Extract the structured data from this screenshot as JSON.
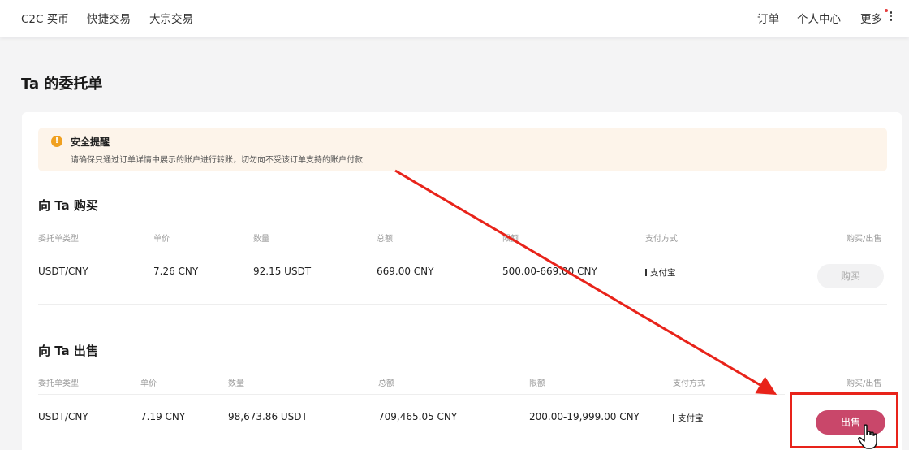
{
  "nav": {
    "left": [
      "C2C 买币",
      "快捷交易",
      "大宗交易"
    ],
    "orders": "订单",
    "profile": "个人中心",
    "more": "更多"
  },
  "page_title": "Ta 的委托单",
  "alert": {
    "icon": "!",
    "title": "安全提醒",
    "text": "请确保只通过订单详情中展示的账户进行转账，切勿向不受该订单支持的账户付款"
  },
  "buy_section": {
    "title": "向 Ta 购买",
    "headers": [
      "委托单类型",
      "单价",
      "数量",
      "总额",
      "限额",
      "支付方式",
      "购买/出售"
    ],
    "row": {
      "type": "USDT/CNY",
      "price": "7.26 CNY",
      "amount": "92.15 USDT",
      "total": "669.00 CNY",
      "limit": "500.00-669.00 CNY",
      "payment": "支付宝",
      "action": "购买"
    }
  },
  "sell_section": {
    "title": "向 Ta 出售",
    "headers": [
      "委托单类型",
      "单价",
      "数量",
      "总额",
      "限额",
      "支付方式",
      "购买/出售"
    ],
    "row": {
      "type": "USDT/CNY",
      "price": "7.19 CNY",
      "amount": "98,673.86 USDT",
      "total": "709,465.05 CNY",
      "limit": "200.00-19,999.00 CNY",
      "payment": "支付宝",
      "action": "出售"
    }
  },
  "colors": {
    "sell_button": "#c9476a",
    "annotation_red": "#e8231a",
    "alert_bg": "#fdf4ea",
    "alert_icon": "#f0a020"
  },
  "icons": {
    "alert": "warning-icon",
    "more": "kebab-menu-icon",
    "cursor": "hand-pointer-icon"
  }
}
